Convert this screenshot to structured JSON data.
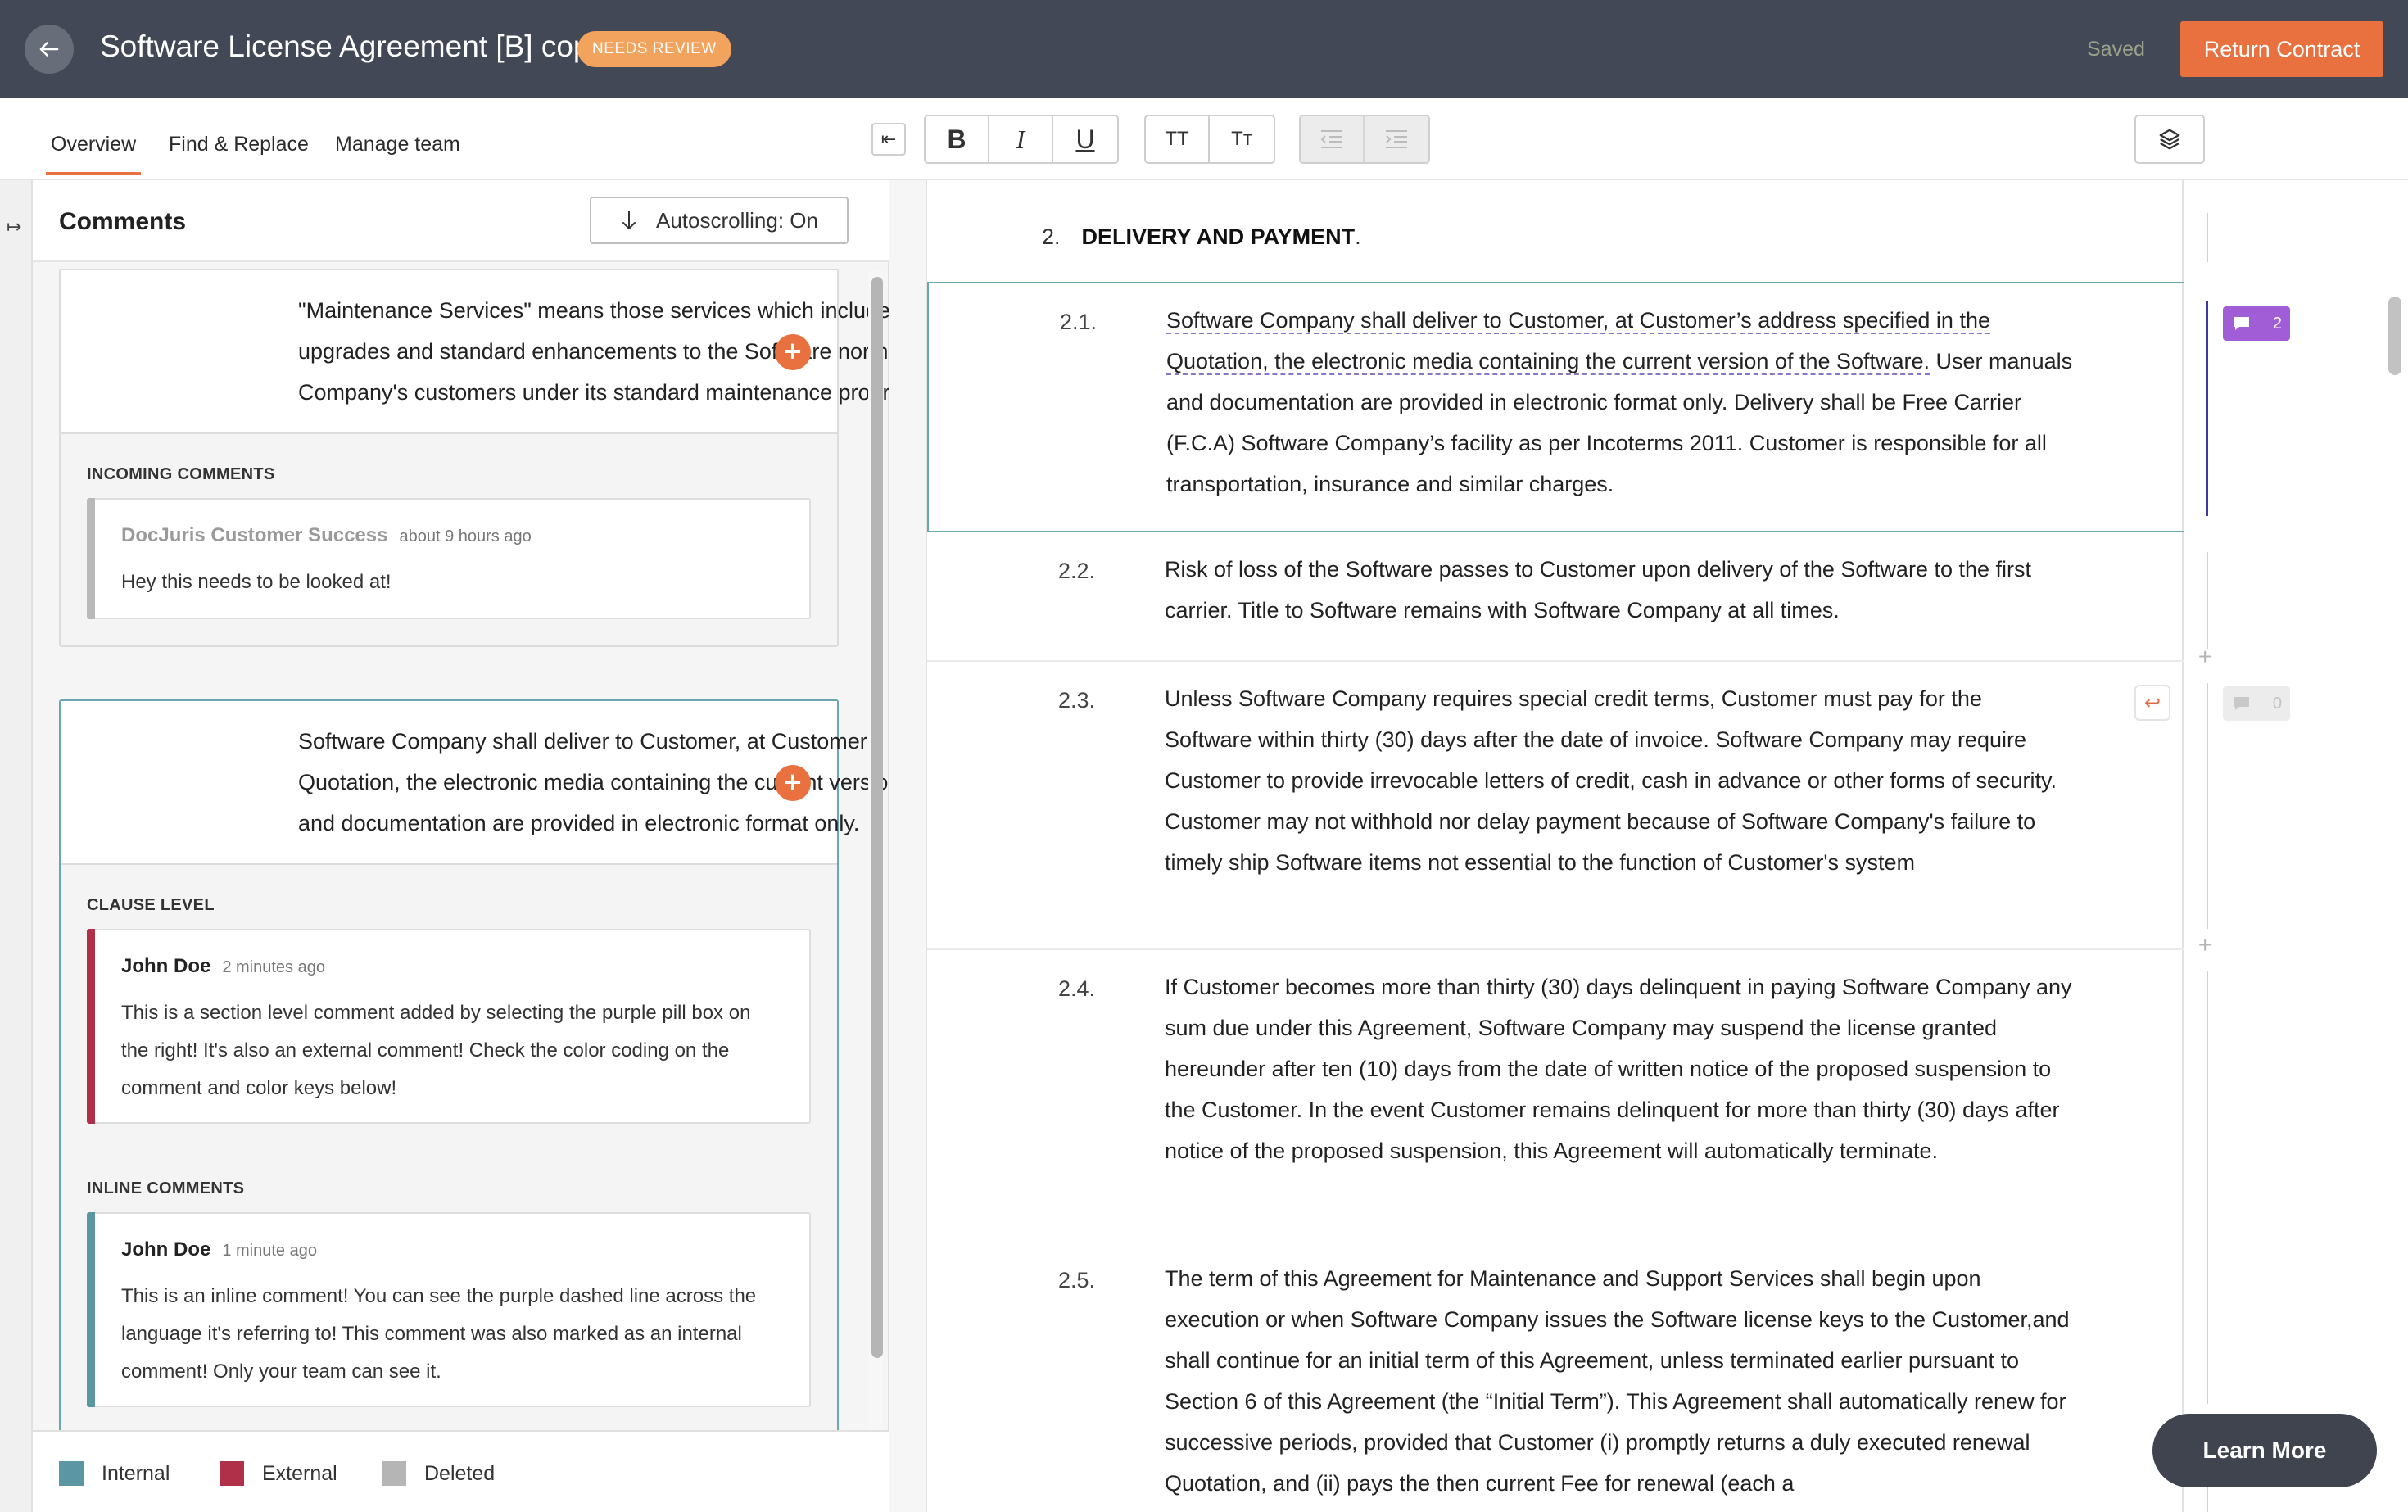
{
  "header": {
    "title": "Software License Agreement [B] copy",
    "status_badge": "NEEDS REVIEW",
    "saved_text": "Saved",
    "return_button": "Return Contract"
  },
  "tabs": [
    {
      "label": "Overview",
      "active": true
    },
    {
      "label": "Find & Replace",
      "active": false
    },
    {
      "label": "Manage team",
      "active": false
    }
  ],
  "toolbar": {
    "bold": "B",
    "italic": "I",
    "underline": "U",
    "uppercase": "TT",
    "capitalize": "Tт"
  },
  "comments_panel": {
    "title": "Comments",
    "autoscroll_label": "Autoscrolling: On",
    "cards": [
      {
        "clause_text": "\"Maintenance Services\" means those services which include the delivery of updates, upgrades and standard enhancements to the Software normally provided to Software Company's customers under its standard maintenance program.",
        "sections": [
          {
            "label": "INCOMING COMMENTS",
            "comments": [
              {
                "author": "DocJuris Customer Success",
                "time": "about 9 hours ago",
                "body": "Hey this needs to be looked at!",
                "color": "#b9b9b9"
              }
            ]
          }
        ]
      },
      {
        "clause_text": "Software Company shall deliver to Customer, at Customer’s address specified in the Quotation, the electronic media containing the current version of the Software. User manuals and documentation are provided in electronic format only.",
        "sections": [
          {
            "label": "CLAUSE LEVEL",
            "comments": [
              {
                "author": "John Doe",
                "time": "2 minutes ago",
                "body": "This is a section level comment added by selecting the purple pill box on the right! It's also an external comment! Check the color coding on the comment and color keys below!",
                "color": "#b0304a"
              }
            ]
          },
          {
            "label": "INLINE COMMENTS",
            "comments": [
              {
                "author": "John Doe",
                "time": "1 minute ago",
                "body": "This is an inline comment! You can see the purple dashed line across the language it's referring to! This comment was also marked as an internal comment! Only your team can see it.",
                "color": "#5b96a3"
              }
            ]
          }
        ]
      }
    ],
    "legend": [
      {
        "label": "Internal",
        "color": "#5b96a3"
      },
      {
        "label": "External",
        "color": "#b0304a"
      },
      {
        "label": "Deleted",
        "color": "#b5b5b5"
      }
    ]
  },
  "document": {
    "section_number": "2.",
    "section_title": "DELIVERY AND PAYMENT",
    "section_title_suffix": ".",
    "clauses": [
      {
        "number": "2.1.",
        "marked_text": "Software Company shall deliver to Customer, at Customer’s address specified in the Quotation, the electronic media containing the current version of the Software.",
        "rest_text": "  User manuals and documentation are provided in electronic format only.  Delivery shall be Free Carrier (F.C.A) Software Company’s facility as per Incoterms 2011.  Customer is responsible for all transportation, insurance and similar charges."
      },
      {
        "number": "2.2.",
        "text": "Risk of loss of the Software passes to Customer upon delivery of the Software to the first carrier.  Title to Software remains with Software Company at all times."
      },
      {
        "number": "2.3.",
        "text": "Unless Software Company requires special credit terms, Customer must pay for the Software within thirty (30) days after the date of invoice.  Software Company may require Customer to provide irrevocable letters of credit, cash in advance or other forms of security.  Customer may not withhold nor delay payment because of Software Company's failure to timely ship Software items not essential to the function of Customer's system"
      },
      {
        "number": "2.4.",
        "text": "If Customer becomes more than thirty (30) days delinquent in paying Software Company any sum due under this Agreement, Software Company may suspend the license granted hereunder after ten (10) days from the date of written notice of the proposed suspension to the Customer.  In the event Customer remains delinquent for more than thirty (30) days after notice of the proposed suspension, this Agreement will automatically terminate."
      },
      {
        "number": "2.5.",
        "text": "The term of this Agreement for Maintenance and Support Services shall begin upon execution or when Software Company issues the Software license keys to the Customer,and shall continue for an initial term of this Agreement, unless terminated earlier pursuant to Section 6 of this Agreement (the “Initial Term”).  This Agreement shall automatically renew for successive periods, provided that Customer (i) promptly returns a duly executed renewal Quotation, and (ii) pays the then current Fee for renewal (each a"
      }
    ]
  },
  "gutter": {
    "pill_count_active": "2",
    "pill_count_empty": "0",
    "plus": "+"
  },
  "learn_more": "Learn More",
  "colors": {
    "topbar": "#424855",
    "accent": "#e8713f",
    "selected_border": "#6aa7b0",
    "comment_pill": "#a05dd6"
  }
}
